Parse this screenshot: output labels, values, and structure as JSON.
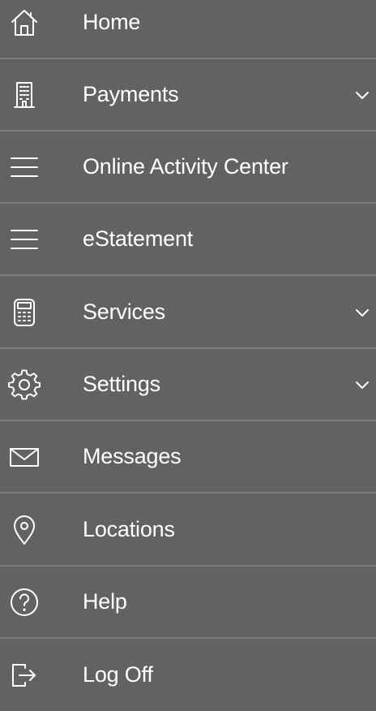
{
  "menu": {
    "items": [
      {
        "label": "Home",
        "icon": "home-icon",
        "expandable": false
      },
      {
        "label": "Payments",
        "icon": "building-icon",
        "expandable": true
      },
      {
        "label": "Online Activity Center",
        "icon": "menu-lines-icon",
        "expandable": false
      },
      {
        "label": "eStatement",
        "icon": "menu-lines-icon",
        "expandable": false
      },
      {
        "label": "Services",
        "icon": "calculator-icon",
        "expandable": true
      },
      {
        "label": "Settings",
        "icon": "gear-icon",
        "expandable": true
      },
      {
        "label": "Messages",
        "icon": "envelope-icon",
        "expandable": false
      },
      {
        "label": "Locations",
        "icon": "location-pin-icon",
        "expandable": false
      },
      {
        "label": "Help",
        "icon": "help-icon",
        "expandable": false
      },
      {
        "label": "Log Off",
        "icon": "log-off-icon",
        "expandable": false
      }
    ]
  },
  "colors": {
    "background": "#626262",
    "divider": "#7c7c7c",
    "text": "#ffffff"
  }
}
